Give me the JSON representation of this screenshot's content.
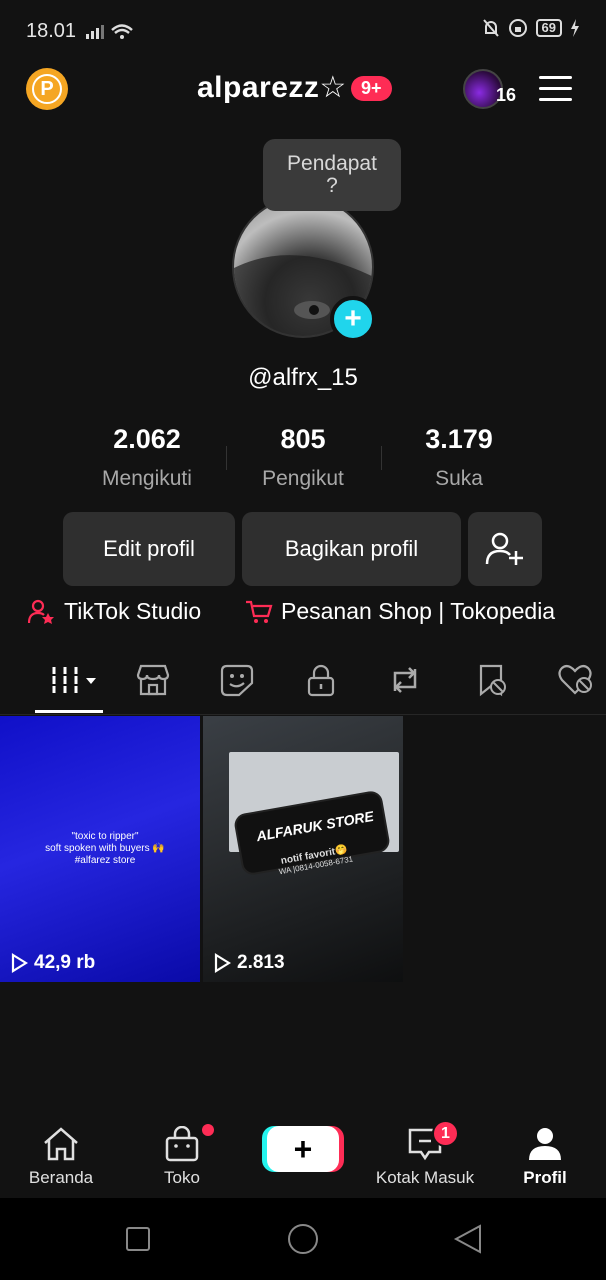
{
  "status_bar": {
    "time": "18.01",
    "battery": "69"
  },
  "header": {
    "username": "alparezz☆",
    "notifications_badge": "9+",
    "avatar_count": "16"
  },
  "tooltip": {
    "text": "Pendapat\n?"
  },
  "profile": {
    "handle": "@alfrx_15",
    "stats": [
      {
        "value": "2.062",
        "label": "Mengikuti"
      },
      {
        "value": "805",
        "label": "Pengikut"
      },
      {
        "value": "3.179",
        "label": "Suka"
      }
    ]
  },
  "buttons": {
    "edit": "Edit profil",
    "share": "Bagikan profil"
  },
  "links": {
    "studio": "TikTok Studio",
    "shop": "Pesanan Shop | Tokopedia"
  },
  "tabs": [
    "videos-tab",
    "shop-tab",
    "sticker-tab",
    "private-tab",
    "repost-tab",
    "favorites-tab",
    "liked-tab"
  ],
  "videos": [
    {
      "views": "42,9 rb",
      "caption": "\"toxic to ripper\"\nsoft spoken with buyers 🙌\n#alfarez store"
    },
    {
      "views": "2.813",
      "title": "ALFARUK STORE",
      "subtitle": "notif favorit🤭",
      "contact": "WA |0814-0058-6731"
    }
  ],
  "nav": {
    "home": "Beranda",
    "shop": "Toko",
    "inbox": "Kotak Masuk",
    "inbox_badge": "1",
    "profile": "Profil"
  },
  "colors": {
    "accent": "#fe2c55",
    "cyan": "#20d5ec",
    "background": "#121212"
  }
}
